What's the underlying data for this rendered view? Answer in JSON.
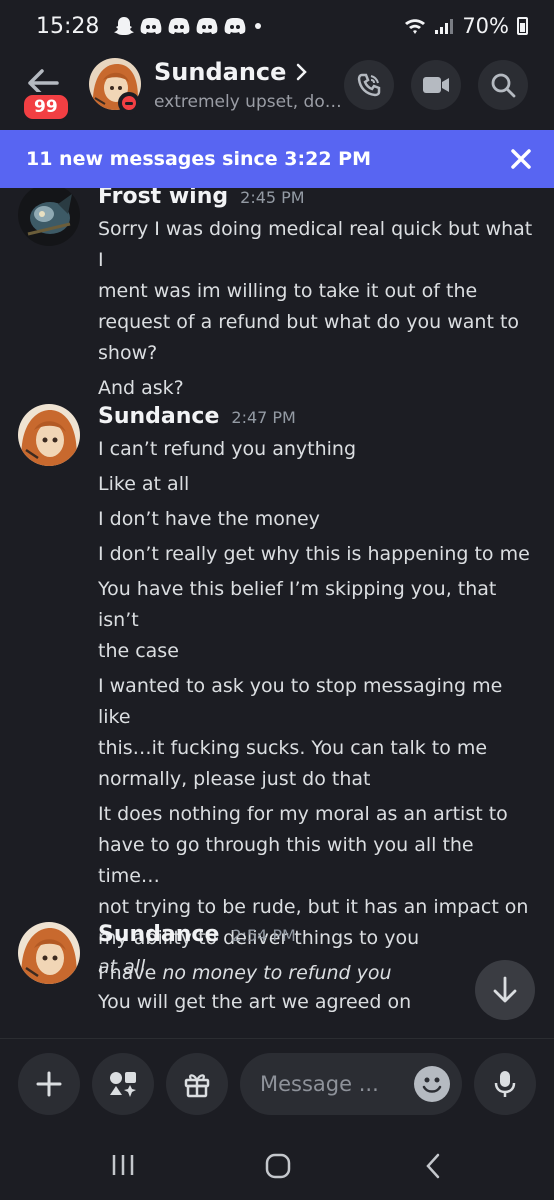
{
  "status_bar": {
    "time": "15:28",
    "battery": "70%"
  },
  "header": {
    "unread_count": "99",
    "name": "Sundance",
    "status": "extremely upset, don..."
  },
  "banner": {
    "text": "11 new messages since 3:22 PM"
  },
  "messages": [
    {
      "author": "Frost wing",
      "time": "2:45 PM",
      "lines": [
        "Sorry I was doing medical real quick but what I",
        "ment was im willing to take it out of the",
        "request of a refund but what do you want to",
        "show?",
        "And ask?"
      ]
    },
    {
      "author": "Sundance",
      "time": "2:47 PM",
      "lines": [
        "I can’t refund you anything",
        "Like at all",
        "I don’t have the money",
        "I don’t really get why this is happening to me",
        "You have this belief I’m skipping you, that isn’t",
        "the case",
        "I wanted to ask you to stop messaging me like",
        "this…it fucking sucks. You can talk to me",
        "normally, please just do that",
        "It does nothing for my moral as an artist to",
        "have to go through this with you all the time…",
        "not trying to be rude, but it has an impact on",
        "my ability to deliver things to you",
        "I have ",
        "no money to refund you"
      ]
    },
    {
      "author": "Sundance",
      "time": "2:54 PM",
      "lines": [
        "at all",
        "You will get the art we agreed on"
      ]
    }
  ],
  "input": {
    "placeholder": "Message ..."
  },
  "colors": {
    "accent": "#5865f2",
    "dnd": "#f23f43",
    "background": "#1c1d23"
  }
}
